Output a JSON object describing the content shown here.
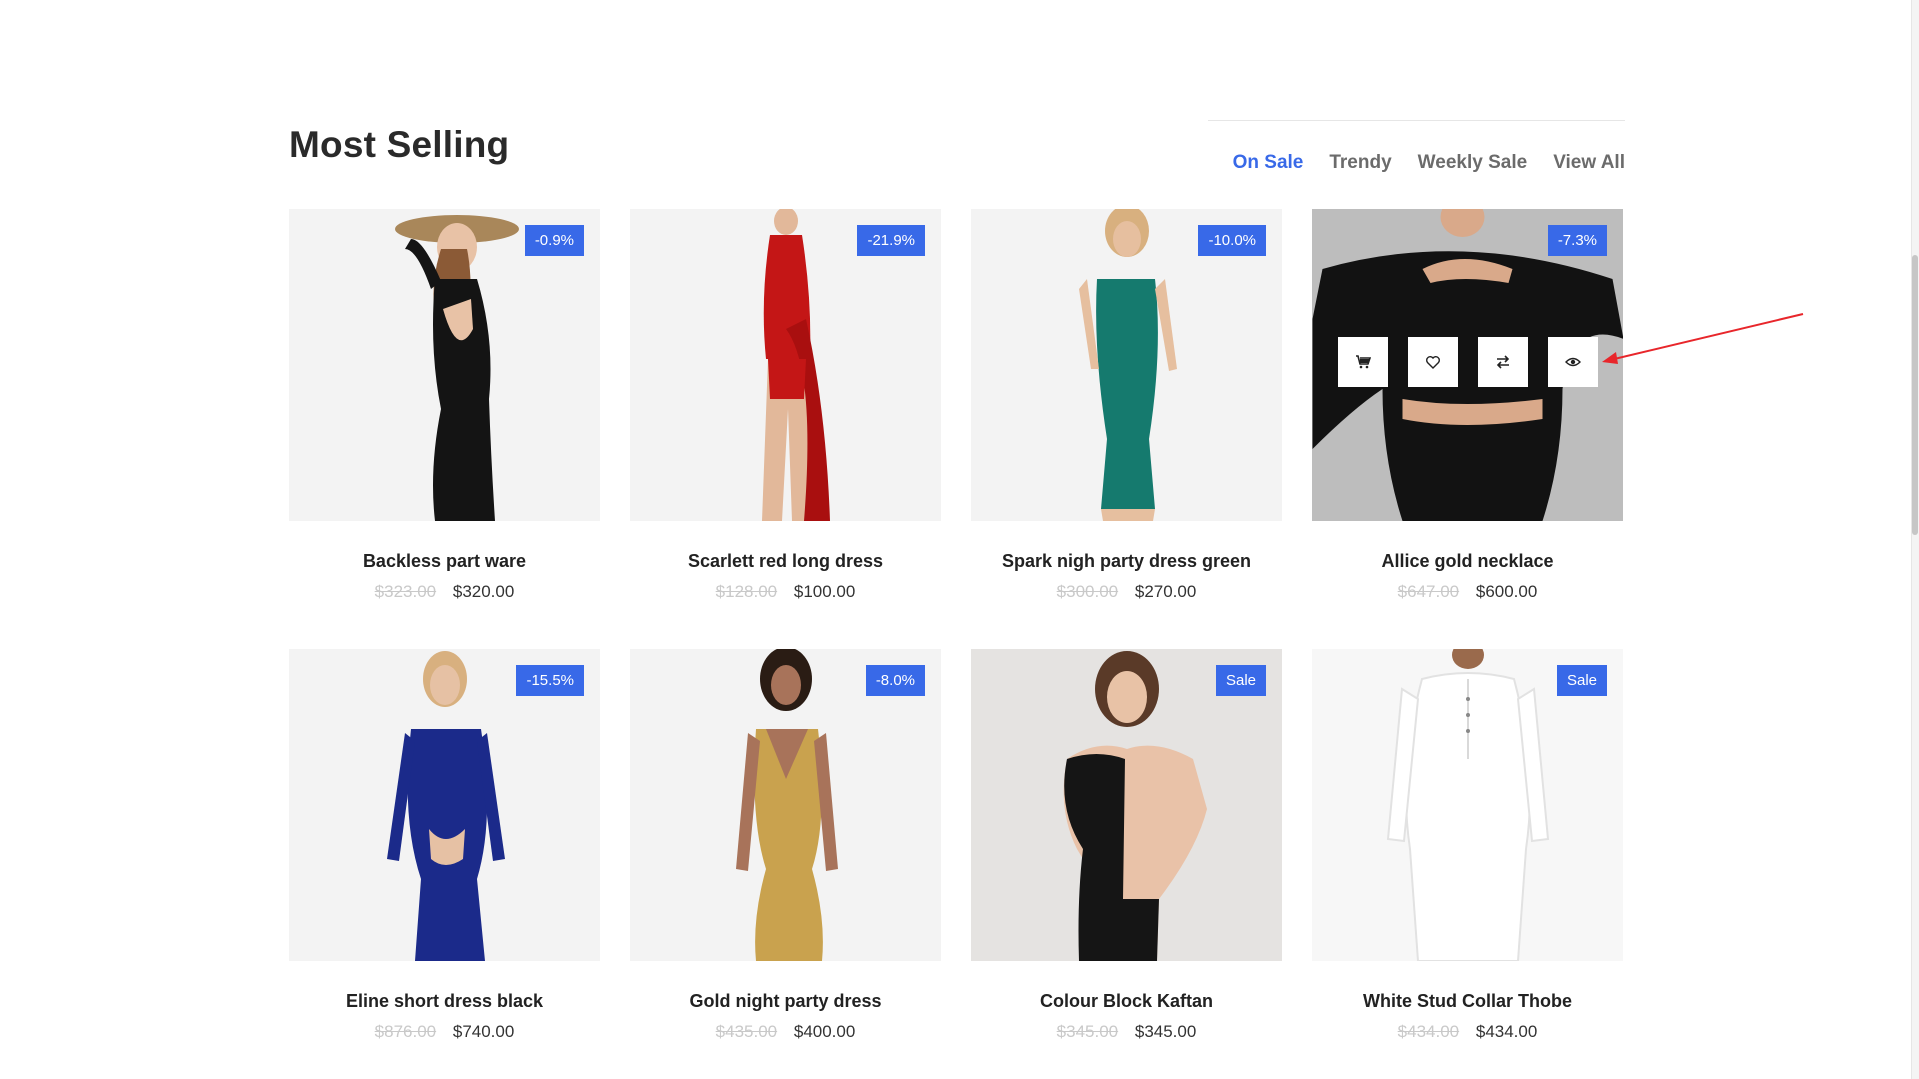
{
  "section": {
    "title": "Most Selling"
  },
  "tabs": [
    {
      "label": "On Sale",
      "active": true
    },
    {
      "label": "Trendy",
      "active": false
    },
    {
      "label": "Weekly Sale",
      "active": false
    },
    {
      "label": "View All",
      "active": false
    }
  ],
  "colors": {
    "accent": "#3869e8",
    "annotation": "#e8262b"
  },
  "products": [
    {
      "name": "Backless part ware",
      "old_price": "$323.00",
      "price": "$320.00",
      "badge": "-0.9%"
    },
    {
      "name": "Scarlett red long dress",
      "old_price": "$128.00",
      "price": "$100.00",
      "badge": "-21.9%"
    },
    {
      "name": "Spark nigh party dress green",
      "old_price": "$300.00",
      "price": "$270.00",
      "badge": "-10.0%"
    },
    {
      "name": "Allice gold necklace",
      "old_price": "$647.00",
      "price": "$600.00",
      "badge": "-7.3%"
    },
    {
      "name": "Eline short dress black",
      "old_price": "$876.00",
      "price": "$740.00",
      "badge": "-15.5%"
    },
    {
      "name": "Gold night party dress",
      "old_price": "$435.00",
      "price": "$400.00",
      "badge": "-8.0%"
    },
    {
      "name": "Colour Block Kaftan",
      "old_price": "$345.00",
      "price": "$345.00",
      "badge": "Sale"
    },
    {
      "name": "White Stud Collar Thobe",
      "old_price": "$434.00",
      "price": "$434.00",
      "badge": "Sale"
    }
  ],
  "hover_actions": [
    "cart-icon",
    "heart-icon",
    "compare-icon",
    "eye-icon"
  ]
}
